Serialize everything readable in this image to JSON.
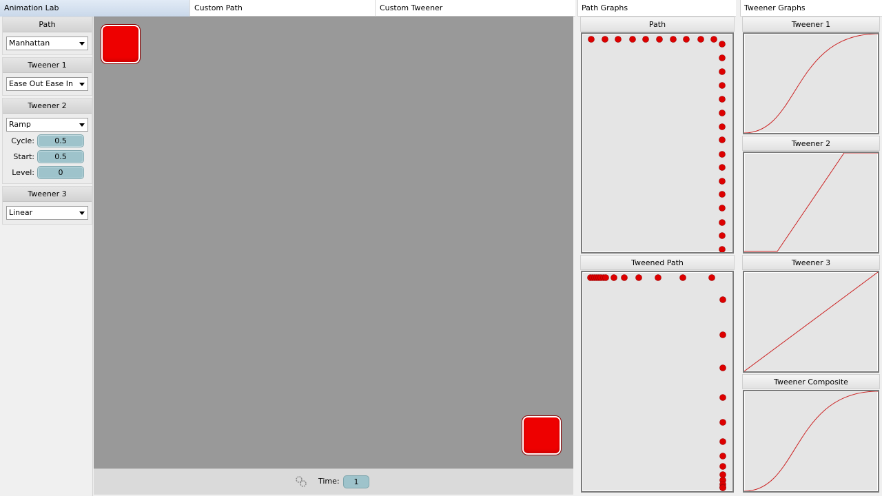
{
  "tabs": [
    "Animation Lab",
    "Custom Path",
    "Custom Tweener"
  ],
  "left_panel": {
    "path": {
      "title": "Path",
      "selected": "Manhattan"
    },
    "tweener1": {
      "title": "Tweener 1",
      "selected": "Ease Out Ease In"
    },
    "tweener2": {
      "title": "Tweener 2",
      "selected": "Ramp",
      "params": [
        {
          "label": "Cycle:",
          "value": "0.5"
        },
        {
          "label": "Start:",
          "value": "0.5"
        },
        {
          "label": "Level:",
          "value": "0"
        }
      ]
    },
    "tweener3": {
      "title": "Tweener 3",
      "selected": "Linear"
    }
  },
  "bottom_bar": {
    "time_label": "Time:",
    "time_value": "1"
  },
  "path_graphs": {
    "header": "Path Graphs",
    "path_title": "Path",
    "tweened_title": "Tweened Path"
  },
  "tweener_graphs": {
    "header": "Tweener Graphs",
    "titles": [
      "Tweener 1",
      "Tweener 2",
      "Tweener 3",
      "Tweener Composite"
    ]
  },
  "colors": {
    "accent": "#ee0000",
    "stage": "#999999",
    "field": "#9ec3cb"
  }
}
